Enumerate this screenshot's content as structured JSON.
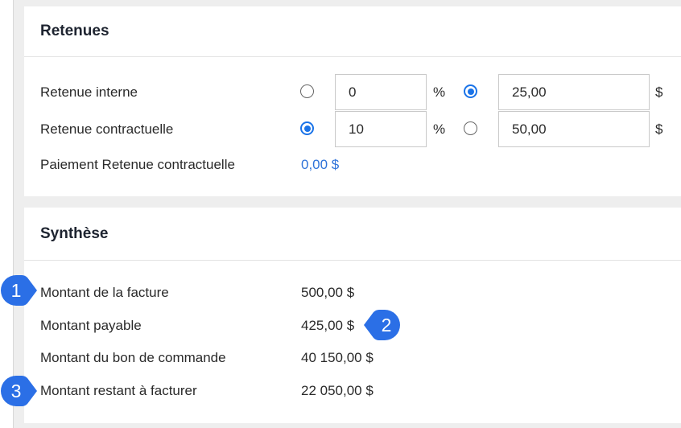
{
  "retenues": {
    "title": "Retenues",
    "rows": [
      {
        "label": "Retenue interne",
        "percent_value": "0",
        "percent_unit": "%",
        "amount_value": "25,00",
        "amount_unit": "$",
        "selected": "amount"
      },
      {
        "label": "Retenue contractuelle",
        "percent_value": "10",
        "percent_unit": "%",
        "amount_value": "50,00",
        "amount_unit": "$",
        "selected": "percent"
      }
    ],
    "payment_label": "Paiement Retenue contractuelle",
    "payment_value": "0,00 $"
  },
  "synthese": {
    "title": "Synthèse",
    "rows": [
      {
        "label": "Montant de la facture",
        "value": "500,00 $"
      },
      {
        "label": "Montant payable",
        "value": "425,00 $"
      },
      {
        "label": "Montant du bon de commande",
        "value": "40 150,00 $"
      },
      {
        "label": "Montant restant à facturer",
        "value": "22 050,00 $"
      }
    ]
  },
  "callouts": [
    "1",
    "2",
    "3"
  ],
  "colors": {
    "accent": "#1a73e8",
    "link": "#2f73d9",
    "callout": "#2b6fe6"
  }
}
